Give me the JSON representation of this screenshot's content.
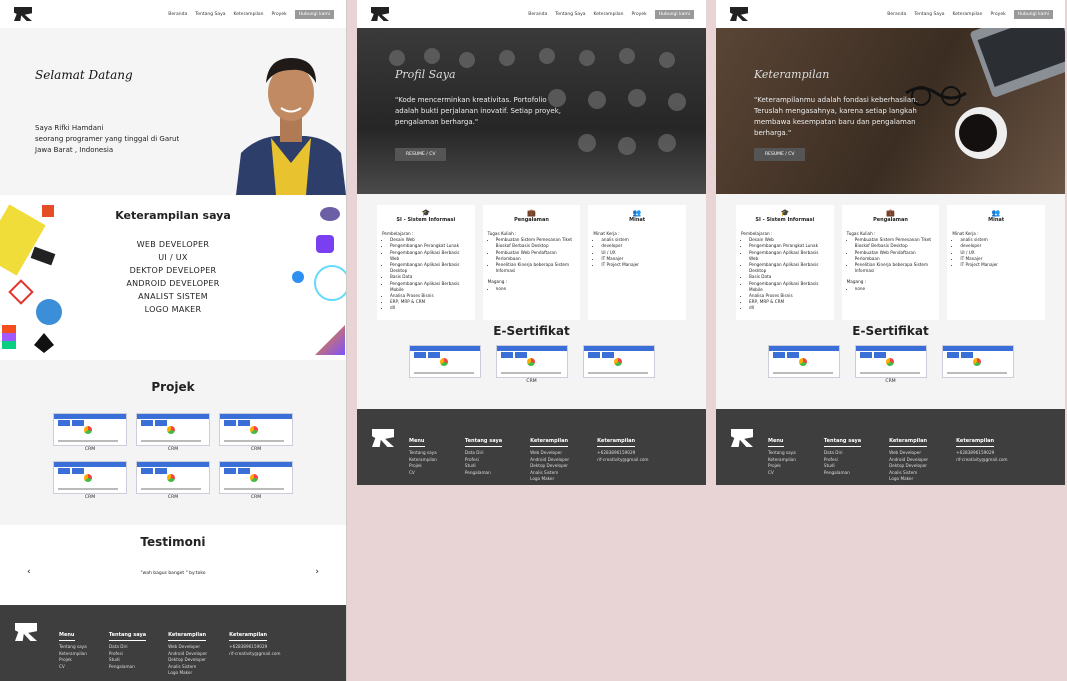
{
  "nav": {
    "links": [
      "Beranda",
      "Tentang Saya",
      "Keterampilan",
      "Proyek"
    ],
    "active": "Hubungi kami"
  },
  "home": {
    "greeting": "Selamat Datang",
    "intro": [
      "Saya Rifki Hamdani",
      "seorang programer yang tinggal di Garut",
      "Jawa Barat , Indonesia"
    ],
    "skills_title": "Keterampilan saya",
    "skills": [
      "WEB DEVELOPER",
      "UI / UX",
      "DEKTOP DEVELOPER",
      "ANDROID DEVELOPER",
      "ANALIST SISTEM",
      "LOGO MAKER"
    ],
    "projects_title": "Projek",
    "project_caption": "CRM",
    "testimonial_title": "Testimoni",
    "testimonial_quote": "\"wah bagus banget \" by:toko",
    "prev": "‹",
    "next": "›"
  },
  "footer": {
    "menu_title": "Menu",
    "menu": [
      "Tentang saya",
      "Keterampilan",
      "Projek",
      "CV"
    ],
    "about_title": "Tentang saya",
    "about": [
      "Data Diri",
      "Profesi",
      "Studi",
      "Pengalaman"
    ],
    "skills_title": "Keterampilan",
    "skills": [
      "Web Developer",
      "Android Developer",
      "Dektop Developer",
      "Analis Sistem",
      "Logo Maker"
    ],
    "contact_title": "Keterampilan",
    "contact": [
      "+6283896159029",
      "rif-creativity@gmail.com"
    ]
  },
  "profile": {
    "title": "Profil Saya",
    "text": "\"Kode mencerminkan kreativitas. Portofolio adalah bukti perjalanan inovatif. Setiap proyek, pengalaman berharga.\"",
    "button": "RESUME / CV"
  },
  "skillspage": {
    "title": "Keterampilan",
    "text": "\"Keterampilanmu adalah fondasi keberhasilan. Teruslah mengasahnya, karena setiap langkah membawa kesempatan baru dan pengalaman berharga.\"",
    "button": "RESUME / CV"
  },
  "cards": {
    "edu_title": "SI - Sistem Informasi",
    "edu_sub": "Pembelajaran :",
    "edu_items": [
      "Desain Web",
      "Pengembangan Perangkat Lunak",
      "Pengembangan Aplikasi Berbasis Web",
      "Pengembangan Aplikasi Berbasis Desktop",
      "Basis Data",
      "Pengembangan Aplikasi Berbasis Mobile",
      "Analisa Proses Bisnis",
      "ERP, MRP & CRM",
      "dll"
    ],
    "exp_title": "Pengalaman",
    "exp_sub": "Tugas Kuliah :",
    "exp_items": [
      "Pembuatan Sistem Pemesanan Tiket Bioskof Berbasis Desktop",
      "Pembuatan Web Pendaftaran Perlombaan",
      "Penelitian Kinerja beberapa Sistem Informasi"
    ],
    "exp_sub2": "Magang :",
    "exp_items2": [
      "none"
    ],
    "int_title": "Minat",
    "int_sub": "Minat Kerja :",
    "int_items": [
      "analis sistem",
      "developer",
      "UI / UX",
      "IT Manajer",
      "IT Project Manajer"
    ],
    "int_items_b": [
      "analis sistem",
      "developer",
      "UI / UX",
      "IT Manajer",
      "IT Project Manajer"
    ]
  },
  "cert": {
    "title": "E-Sertifikat",
    "caption": "CRM"
  }
}
